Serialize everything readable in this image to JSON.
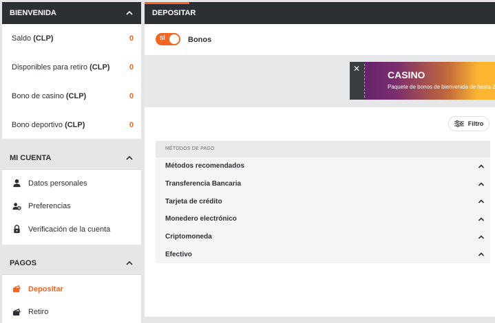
{
  "welcome": {
    "title": "BIENVENIDA",
    "rows": [
      {
        "label": "Saldo ",
        "unit": "(CLP)",
        "value": "0"
      },
      {
        "label": "Disponibles para retiro ",
        "unit": "(CLP)",
        "value": "0"
      },
      {
        "label": "Bono de casino ",
        "unit": "(CLP)",
        "value": "0"
      },
      {
        "label": "Bono deportivo ",
        "unit": "(CLP)",
        "value": "0"
      }
    ]
  },
  "account": {
    "title": "MI CUENTA",
    "items": [
      {
        "label": "Datos personales",
        "icon": "user-icon"
      },
      {
        "label": "Preferencias",
        "icon": "preferences-icon"
      },
      {
        "label": "Verificación de la cuenta",
        "icon": "lock-icon"
      }
    ]
  },
  "payments": {
    "title": "PAGOS",
    "items": [
      {
        "label": "Depositar",
        "icon": "deposit-icon",
        "active": true
      },
      {
        "label": "Retiro",
        "icon": "withdraw-icon",
        "active": false
      }
    ]
  },
  "main": {
    "title": "DEPOSITAR",
    "toggle": {
      "on_text": "SÍ",
      "label": "Bonos"
    },
    "promo": {
      "title": "CASINO",
      "subtitle": "Paquete de bonos de bienvenida de hasta 2"
    },
    "filter_label": "Filtro",
    "methods_header": "MÉTODOS DE PAGO",
    "methods": [
      "Métodos recomendados",
      "Transferencia Bancaria",
      "Tarjeta de crédito",
      "Monedero electrónico",
      "Criptomoneda",
      "Efectivo"
    ]
  },
  "colors": {
    "accent": "#f26522",
    "header_dark": "#2c3035"
  }
}
